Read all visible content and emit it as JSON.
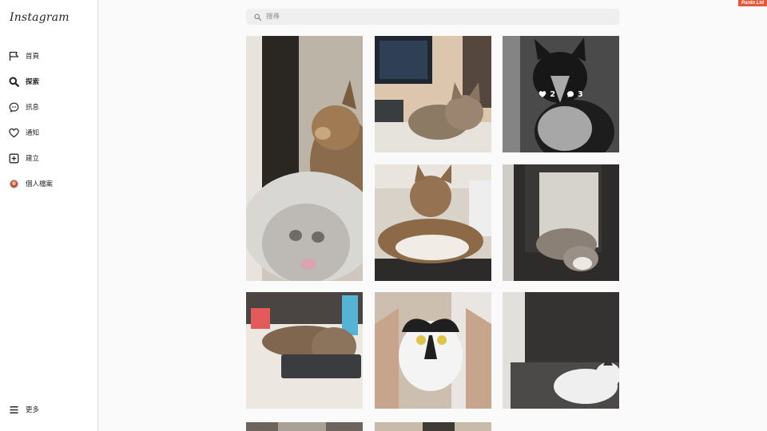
{
  "brand": {
    "logo": "Instagram"
  },
  "sidebar": {
    "items": [
      {
        "label": "首頁",
        "icon": "home-icon"
      },
      {
        "label": "探索",
        "icon": "search-icon"
      },
      {
        "label": "訊息",
        "icon": "messenger-icon"
      },
      {
        "label": "通知",
        "icon": "heart-icon"
      },
      {
        "label": "建立",
        "icon": "create-icon"
      },
      {
        "label": "個人檔案",
        "icon": "avatar"
      }
    ],
    "more_label": "更多"
  },
  "search": {
    "placeholder": "搜尋"
  },
  "grid": {
    "hover_tile": {
      "likes": "2",
      "comments": "3"
    }
  },
  "watermark": {
    "text": "Pardn Ltd"
  },
  "colors": {
    "sidebar_bg": "#ffffff",
    "page_bg": "#fafafa",
    "search_bg": "#efefef",
    "text": "#262626",
    "watermark_bg": "#e8563a"
  }
}
